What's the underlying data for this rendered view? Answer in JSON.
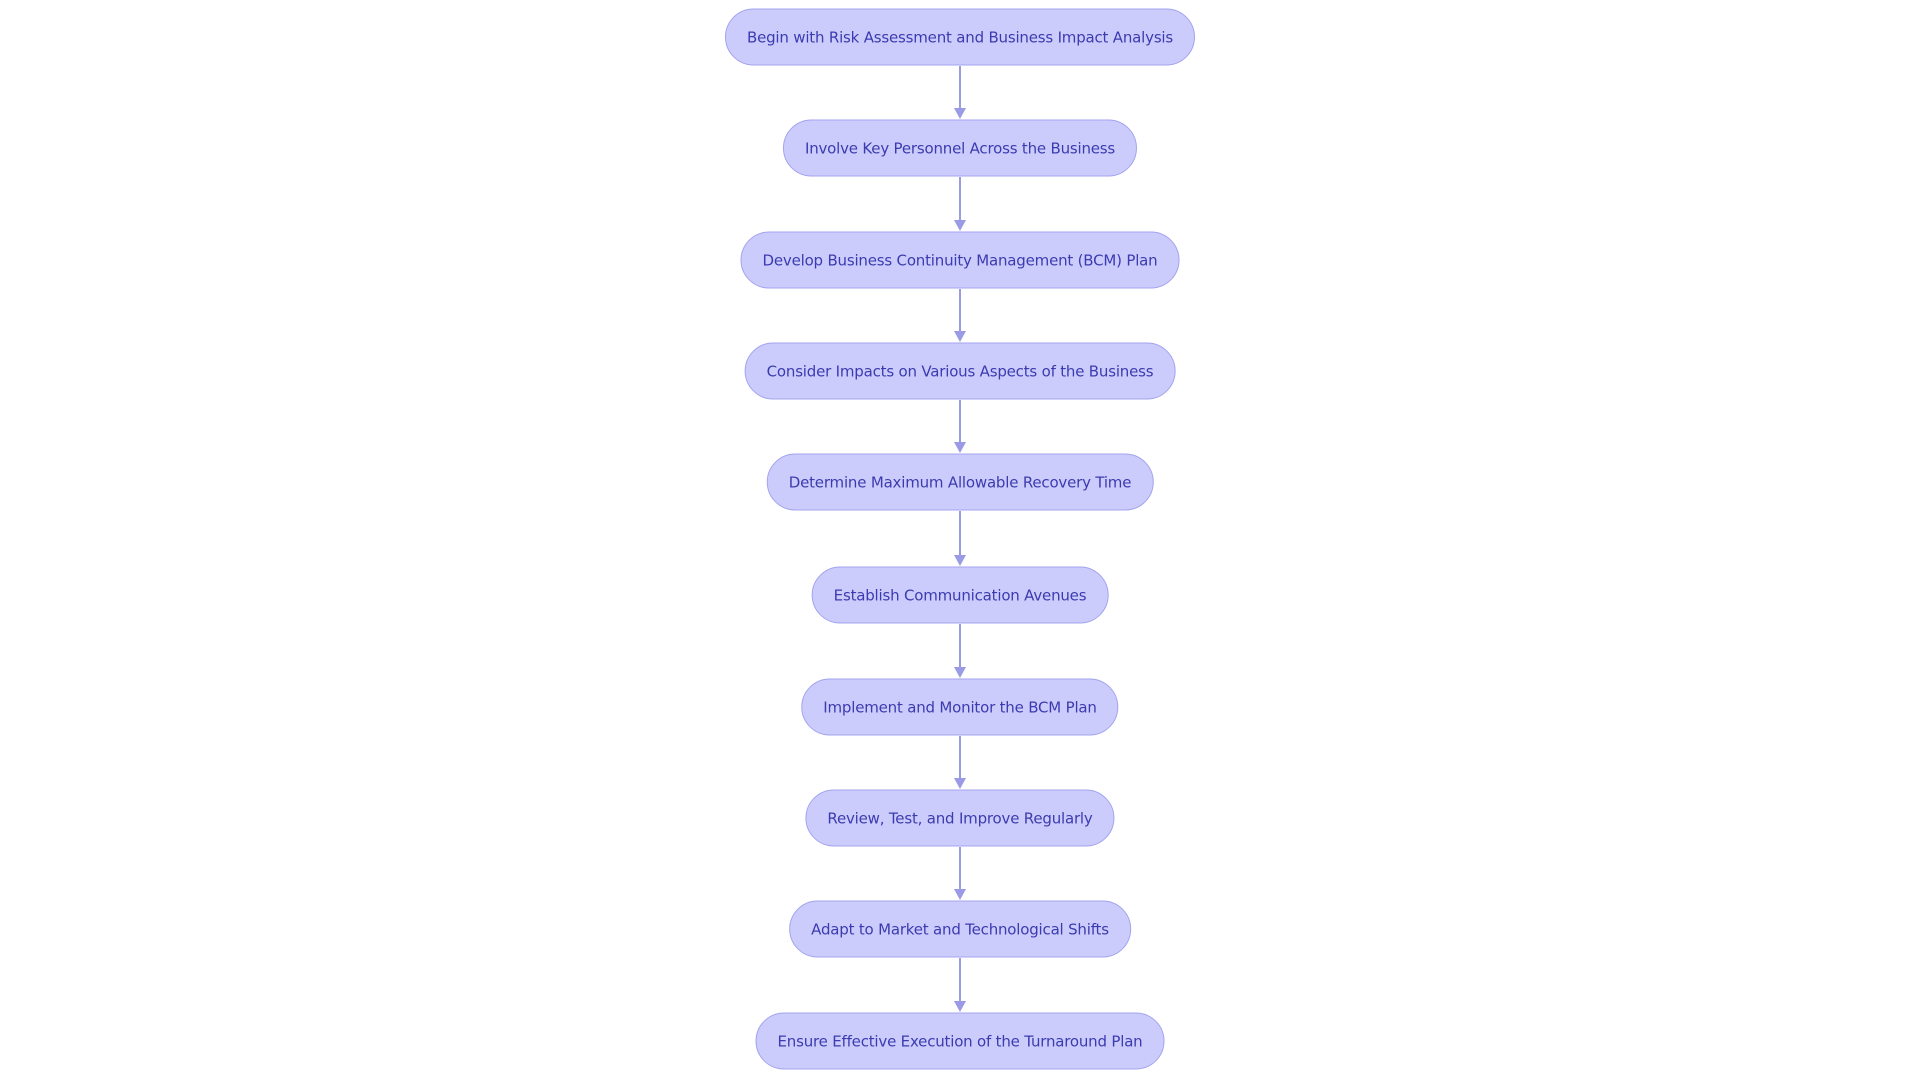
{
  "colors": {
    "node_fill": "#ccccfc",
    "node_border": "#a3a3ef",
    "text": "#3b3bb0",
    "edge": "#9a9ae6"
  },
  "nodes": [
    {
      "label": "Begin with Risk Assessment and Business Impact Analysis"
    },
    {
      "label": "Involve Key Personnel Across the Business"
    },
    {
      "label": "Develop Business Continuity Management (BCM) Plan"
    },
    {
      "label": "Consider Impacts on Various Aspects of the Business"
    },
    {
      "label": "Determine Maximum Allowable Recovery Time"
    },
    {
      "label": "Establish Communication Avenues"
    },
    {
      "label": "Implement and Monitor the BCM Plan"
    },
    {
      "label": "Review, Test, and Improve Regularly"
    },
    {
      "label": "Adapt to Market and Technological Shifts"
    },
    {
      "label": "Ensure Effective Execution of the Turnaround Plan"
    }
  ]
}
